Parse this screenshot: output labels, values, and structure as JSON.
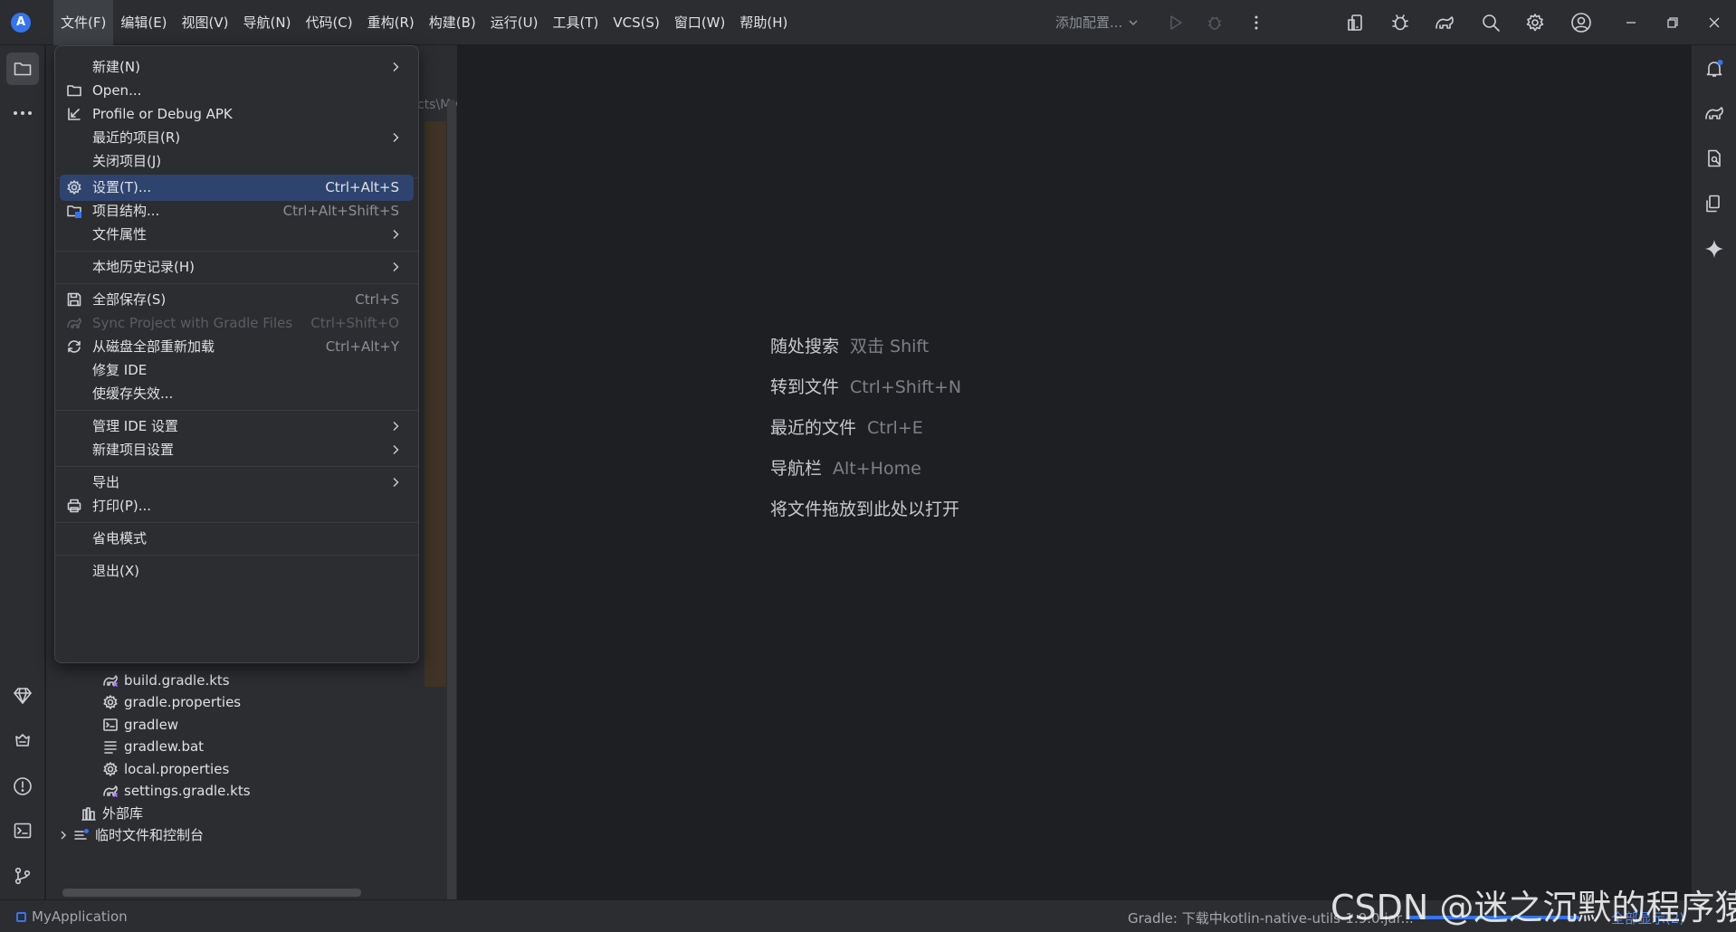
{
  "titlebar": {
    "app_logo": "A",
    "menus": [
      "文件(F)",
      "编辑(E)",
      "视图(V)",
      "导航(N)",
      "代码(C)",
      "重构(R)",
      "构建(B)",
      "运行(U)",
      "工具(T)",
      "VCS(S)",
      "窗口(W)",
      "帮助(H)"
    ],
    "run_config": "添加配置...",
    "icons": [
      "run-icon",
      "debug-icon",
      "more-vertical-icon",
      "device-manager-icon",
      "app-inspection-icon",
      "gradle-sync-icon",
      "search-icon",
      "settings-icon",
      "account-icon",
      "minimize-icon",
      "restore-icon",
      "close-icon"
    ]
  },
  "file_menu": {
    "items": [
      {
        "label": "新建(N)",
        "icon": "",
        "shortcut": "",
        "submenu": true
      },
      {
        "label": "Open...",
        "icon": "folder-icon",
        "shortcut": "",
        "submenu": false
      },
      {
        "label": "Profile or Debug APK",
        "icon": "profile-apk-icon",
        "shortcut": "",
        "submenu": false
      },
      {
        "label": "最近的项目(R)",
        "icon": "",
        "shortcut": "",
        "submenu": true
      },
      {
        "label": "关闭项目(J)",
        "icon": "",
        "shortcut": "",
        "submenu": false
      },
      {
        "label": "设置(T)...",
        "icon": "gear-icon",
        "shortcut": "Ctrl+Alt+S",
        "submenu": false,
        "selected": true
      },
      {
        "label": "项目结构...",
        "icon": "project-structure-icon",
        "shortcut": "Ctrl+Alt+Shift+S",
        "submenu": false
      },
      {
        "label": "文件属性",
        "icon": "",
        "shortcut": "",
        "submenu": true
      },
      {
        "label": "本地历史记录(H)",
        "icon": "",
        "shortcut": "",
        "submenu": true
      },
      {
        "label": "全部保存(S)",
        "icon": "save-icon",
        "shortcut": "Ctrl+S",
        "submenu": false
      },
      {
        "label": "Sync Project with Gradle Files",
        "icon": "gradle-sync-icon",
        "shortcut": "Ctrl+Shift+O",
        "submenu": false,
        "disabled": true
      },
      {
        "label": "从磁盘全部重新加载",
        "icon": "reload-icon",
        "shortcut": "Ctrl+Alt+Y",
        "submenu": false
      },
      {
        "label": "修复 IDE",
        "icon": "",
        "shortcut": "",
        "submenu": false
      },
      {
        "label": "使缓存失效...",
        "icon": "",
        "shortcut": "",
        "submenu": false
      },
      {
        "label": "管理 IDE 设置",
        "icon": "",
        "shortcut": "",
        "submenu": true
      },
      {
        "label": "新建项目设置",
        "icon": "",
        "shortcut": "",
        "submenu": true
      },
      {
        "label": "导出",
        "icon": "",
        "shortcut": "",
        "submenu": true
      },
      {
        "label": "打印(P)...",
        "icon": "print-icon",
        "shortcut": "",
        "submenu": false
      },
      {
        "label": "省电模式",
        "icon": "",
        "shortcut": "",
        "submenu": false
      },
      {
        "label": "退出(X)",
        "icon": "",
        "shortcut": "",
        "submenu": false
      }
    ]
  },
  "project_panel": {
    "path_fragment": "cts\\My",
    "tree": [
      {
        "label": "build.gradle.kts",
        "icon": "gradle-kts-icon"
      },
      {
        "label": "gradle.properties",
        "icon": "properties-gear-icon"
      },
      {
        "label": "gradlew",
        "icon": "terminal-file-icon"
      },
      {
        "label": "gradlew.bat",
        "icon": "text-file-icon"
      },
      {
        "label": "local.properties",
        "icon": "properties-gear-icon"
      },
      {
        "label": "settings.gradle.kts",
        "icon": "gradle-kts-icon"
      },
      {
        "label": "外部库",
        "icon": "library-icon"
      },
      {
        "label": "临时文件和控制台",
        "icon": "scratches-icon"
      }
    ]
  },
  "editor_hints": [
    {
      "label": "随处搜索",
      "key": "双击 Shift"
    },
    {
      "label": "转到文件",
      "key": "Ctrl+Shift+N"
    },
    {
      "label": "最近的文件",
      "key": "Ctrl+E"
    },
    {
      "label": "导航栏",
      "key": "Alt+Home"
    },
    {
      "label": "将文件拖放到此处以打开",
      "key": ""
    }
  ],
  "statusbar": {
    "project": "MyApplication",
    "gradle_status": "Gradle: 下载中kotlin-native-utils-1.9.0.jar...",
    "show_all": "全部显示(2)"
  },
  "watermark": "CSDN @迷之沉默的程序猿",
  "colors": {
    "accent": "#3574f0",
    "selection": "#2e436e",
    "panel": "#2b2d30",
    "editor": "#1e1f22"
  }
}
